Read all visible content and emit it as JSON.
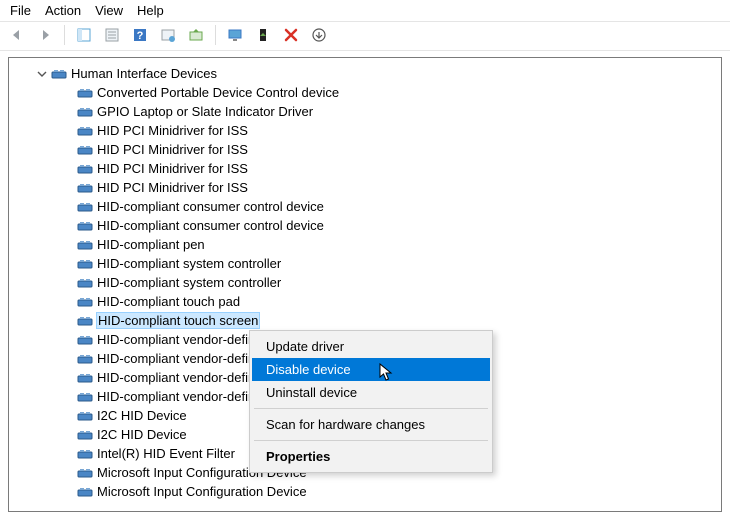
{
  "menubar": {
    "file": "File",
    "action": "Action",
    "view": "View",
    "help": "Help"
  },
  "tree": {
    "category": "Human Interface Devices",
    "devices": [
      "Converted Portable Device Control device",
      "GPIO Laptop or Slate Indicator Driver",
      "HID PCI Minidriver for ISS",
      "HID PCI Minidriver for ISS",
      "HID PCI Minidriver for ISS",
      "HID PCI Minidriver for ISS",
      "HID-compliant consumer control device",
      "HID-compliant consumer control device",
      "HID-compliant pen",
      "HID-compliant system controller",
      "HID-compliant system controller",
      "HID-compliant touch pad",
      "HID-compliant touch screen",
      "HID-compliant vendor-defined device",
      "HID-compliant vendor-defined device",
      "HID-compliant vendor-defined device",
      "HID-compliant vendor-defined device",
      "I2C HID Device",
      "I2C HID Device",
      "Intel(R) HID Event Filter",
      "Microsoft Input Configuration Device",
      "Microsoft Input Configuration Device"
    ],
    "selected_index": 12
  },
  "context_menu": {
    "update": "Update driver",
    "disable": "Disable device",
    "uninstall": "Uninstall device",
    "scan": "Scan for hardware changes",
    "properties": "Properties"
  }
}
